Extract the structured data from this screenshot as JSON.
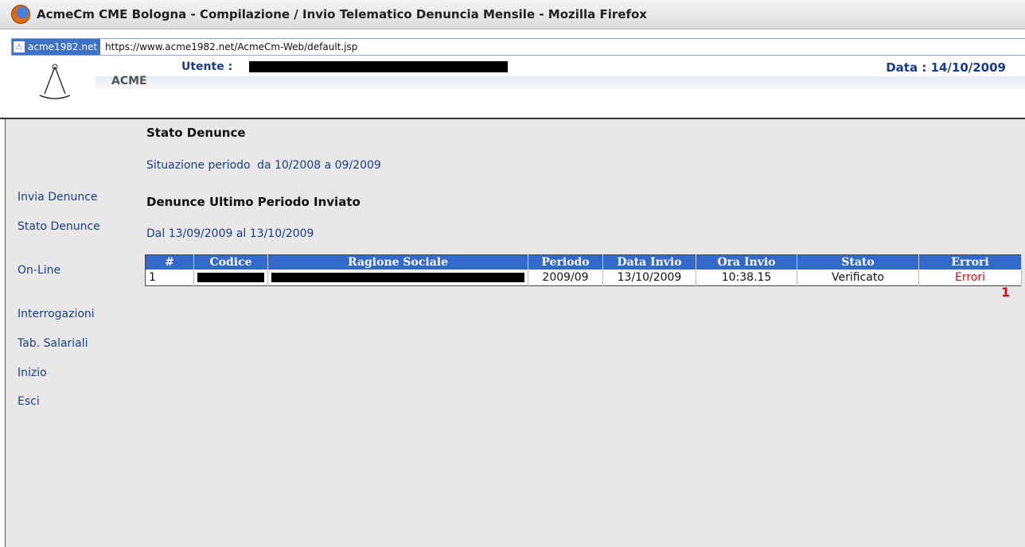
{
  "window": {
    "title": "AcmeCm CME Bologna - Compilazione / Invio Telematico Denuncia Mensile - Mozilla Firefox"
  },
  "address_bar": {
    "site": "acme1982.net",
    "url": "https://www.acme1982.net/AcmeCm-Web/default.jsp"
  },
  "header": {
    "utente_label": "Utente :",
    "data": "Data : 14/10/2009",
    "acme": "ACME"
  },
  "sidebar": {
    "items": [
      {
        "label": "Invia Denunce"
      },
      {
        "label": "Stato Denunce"
      },
      {
        "label": "On-Line"
      },
      {
        "label": "Interrogazioni"
      },
      {
        "label": "Tab. Salariali"
      },
      {
        "label": "Inizio"
      },
      {
        "label": "Esci"
      }
    ]
  },
  "main": {
    "title": "Stato Denunce",
    "situazione_label": "Situazione periodo",
    "situazione_value": "da 10/2008 a 09/2009",
    "section_title": "Denunce Ultimo Periodo Inviato",
    "range": "Dal 13/09/2009 al 13/10/2009",
    "table": {
      "headers": [
        "#",
        "Codice",
        "Ragione Sociale",
        "Periodo",
        "Data Invio",
        "Ora Invio",
        "Stato",
        "Errori"
      ],
      "rows": [
        {
          "num": "1",
          "periodo": "2009/09",
          "data_invio": "13/10/2009",
          "ora_invio": "10:38.15",
          "stato": "Verificato",
          "errori": "Errori"
        }
      ]
    },
    "annotation": "1"
  }
}
